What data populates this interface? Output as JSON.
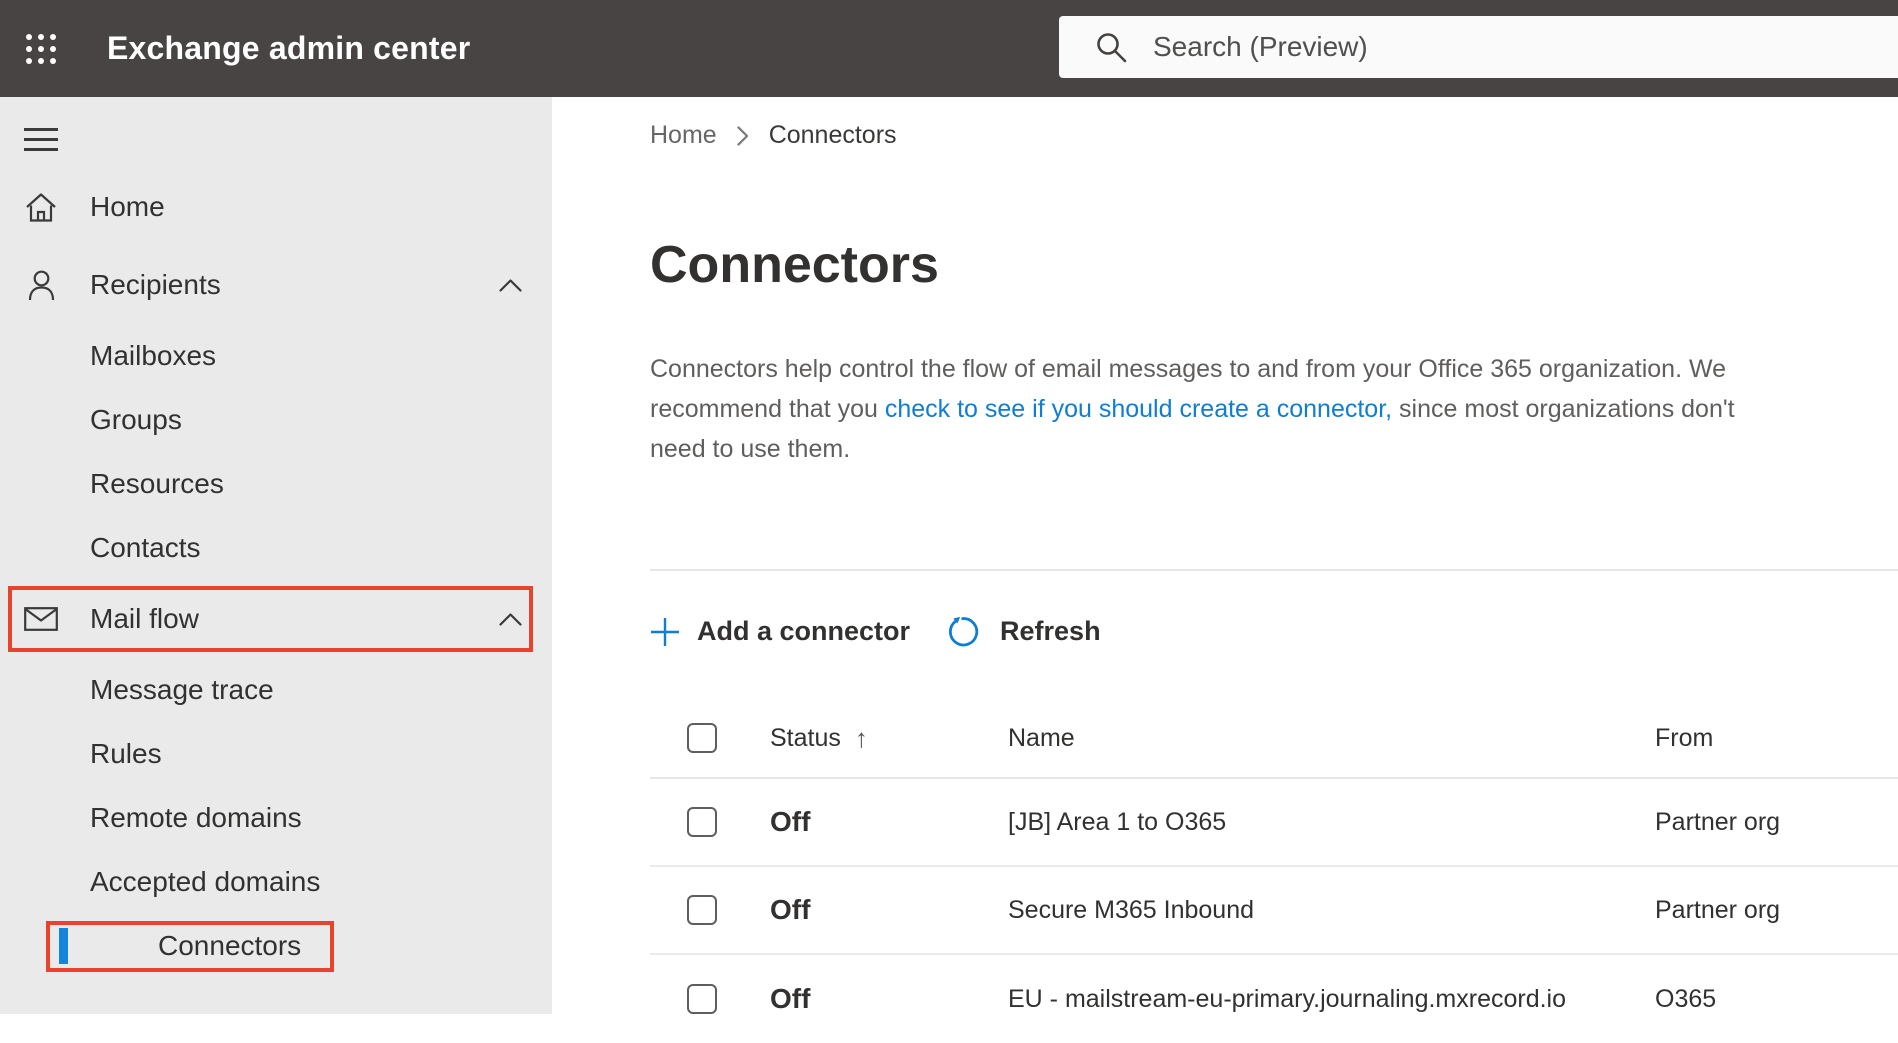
{
  "topbar": {
    "app_title": "Exchange admin center",
    "search_placeholder": "Search (Preview)"
  },
  "sidebar": {
    "items": [
      {
        "label": "Home",
        "type": "top",
        "icon": "home-icon"
      },
      {
        "label": "Recipients",
        "type": "top",
        "icon": "person-icon",
        "expanded": true
      },
      {
        "label": "Mailboxes",
        "type": "sub"
      },
      {
        "label": "Groups",
        "type": "sub"
      },
      {
        "label": "Resources",
        "type": "sub"
      },
      {
        "label": "Contacts",
        "type": "sub"
      },
      {
        "label": "Mail flow",
        "type": "top",
        "icon": "mail-icon",
        "expanded": true,
        "annotated": true
      },
      {
        "label": "Message trace",
        "type": "sub"
      },
      {
        "label": "Rules",
        "type": "sub"
      },
      {
        "label": "Remote domains",
        "type": "sub"
      },
      {
        "label": "Accepted domains",
        "type": "sub"
      },
      {
        "label": "Connectors",
        "type": "sub",
        "selected": true,
        "annotated": true
      }
    ]
  },
  "breadcrumb": {
    "home": "Home",
    "current": "Connectors"
  },
  "page": {
    "title": "Connectors",
    "description": {
      "line1": "Connectors help control the flow of email messages to and from your Office 365 organization. We",
      "line2_prefix": "recommend that you ",
      "link_text": "check to see if you should create a connector,",
      "line2_suffix": " since most organizations don't",
      "line3": "need to use them."
    }
  },
  "toolbar": {
    "add_label": "Add a connector",
    "refresh_label": "Refresh"
  },
  "table": {
    "columns": {
      "status": "Status",
      "name": "Name",
      "from": "From"
    },
    "sort_icon": "↑",
    "rows": [
      {
        "status": "Off",
        "name": "[JB] Area 1 to O365",
        "from": "Partner org"
      },
      {
        "status": "Off",
        "name": "Secure M365 Inbound",
        "from": "Partner org"
      },
      {
        "status": "Off",
        "name": "EU - mailstream-eu-primary.journaling.mxrecord.io",
        "from": "O365"
      }
    ]
  },
  "colors": {
    "accent_blue": "#0f7dd3",
    "selection_blue": "#1385dd",
    "annotation_red": "#e8432d",
    "topbar_bg": "#474443",
    "sidebar_bg": "#eaeaea"
  }
}
